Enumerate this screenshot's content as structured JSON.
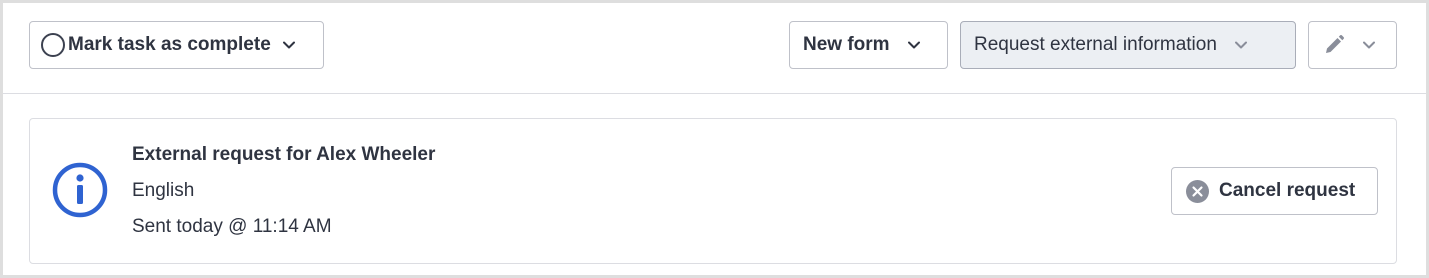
{
  "toolbar": {
    "mark_complete": {
      "label": "Mark task as complete",
      "icon": "circle-icon",
      "caret": "chevron-down-icon"
    },
    "new_form": {
      "label": "New form",
      "caret": "chevron-down-icon"
    },
    "request_info": {
      "label": "Request external information",
      "caret": "chevron-down-icon"
    },
    "edit": {
      "icon": "pencil-icon",
      "caret": "chevron-down-icon"
    }
  },
  "request_card": {
    "icon": "info-icon",
    "title": "External request for Alex Wheeler",
    "language": "English",
    "sent": "Sent today @ 11:14 AM",
    "cancel_label": "Cancel request",
    "cancel_icon": "x-circle-icon"
  },
  "colors": {
    "text": "#2f3441",
    "border": "#bfc1c9",
    "divider": "#dcdde2",
    "info_blue": "#2f63d1",
    "muted_icon": "#8a8e9a",
    "selected_button_bg": "#eceff3"
  }
}
